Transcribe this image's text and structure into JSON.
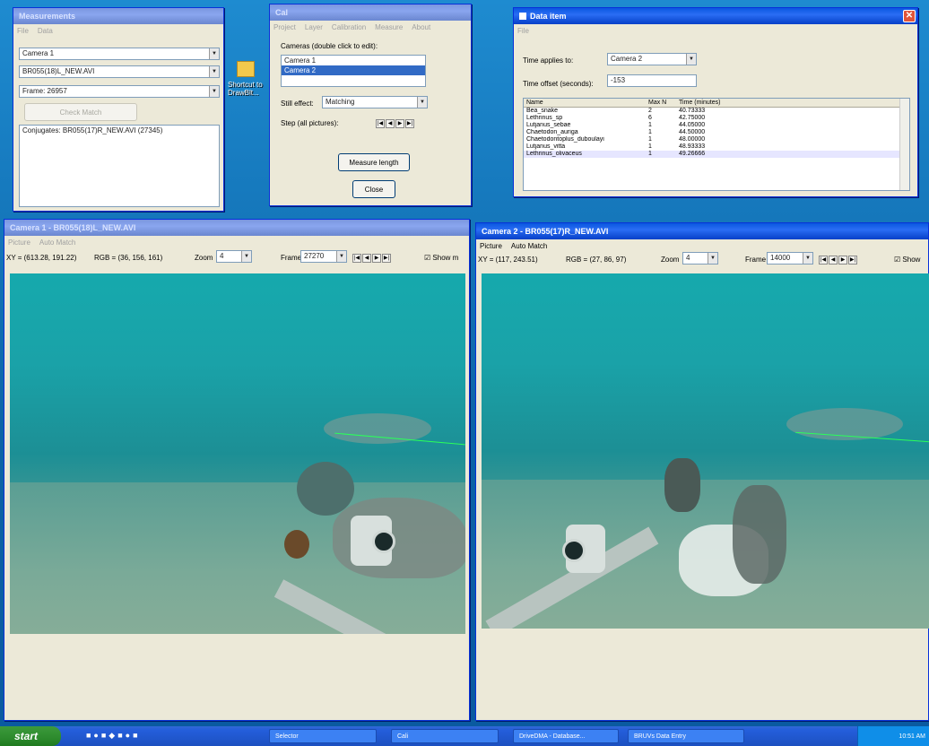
{
  "desktop": {
    "shortcut_label": "Shortcut to DrawBlt..."
  },
  "measurements": {
    "title": "Measurements",
    "menu": [
      "File",
      "Data"
    ],
    "camera_select": "Camera 1",
    "file_select": "BR055(18)L_NEW.AVI",
    "frame_select": "Frame: 26957",
    "disabled_button": "Check Match",
    "conjugate_text": "Conjugates: BR055(17)R_NEW.AVI (27345)"
  },
  "cal": {
    "title": "Cal",
    "menu": [
      "Project",
      "Layer",
      "Calibration",
      "Measure",
      "About"
    ],
    "cameras_label": "Cameras (double click to edit):",
    "cameras": [
      "Camera 1",
      "Camera 2"
    ],
    "stills_label": "Still effect:",
    "stills_value": "Matching",
    "step_label": "Step (all pictures):",
    "measure_button": "Measure length",
    "close_button": "Close"
  },
  "data_item": {
    "title": "Data item",
    "menu": [
      "File"
    ],
    "time_applies_label": "Time applies to:",
    "time_applies_value": "Camera 2",
    "time_offset_label": "Time offset (seconds):",
    "time_offset_value": "-153",
    "columns": [
      "Name",
      "Max N",
      "Time (minutes)"
    ],
    "rows": [
      [
        "Bea_snake",
        "2",
        "40.73333"
      ],
      [
        "Lethrinus_sp",
        "6",
        "42.75000"
      ],
      [
        "Lutjanus_sebae",
        "1",
        "44.05000"
      ],
      [
        "Chaetodon_auriga",
        "1",
        "44.50000"
      ],
      [
        "Chaetodontoplus_duboulayi",
        "1",
        "48.00000"
      ],
      [
        "Lutjanus_vitta",
        "1",
        "48.93333"
      ],
      [
        "Lethrinus_olivaceus",
        "1",
        "49.26666"
      ]
    ]
  },
  "camera1": {
    "title": "Camera 1 - BR055(18)L_NEW.AVI",
    "menu": [
      "Picture",
      "Auto Match"
    ],
    "xy": "XY = (613.28, 191.22)",
    "rgb": "RGB = (36, 156, 161)",
    "zoom_label": "Zoom",
    "zoom_value": "4",
    "frame_label": "Frame",
    "frame_value": "27270",
    "show_label": "Show m"
  },
  "camera2": {
    "title": "Camera 2 - BR055(17)R_NEW.AVI",
    "menu": [
      "Picture",
      "Auto Match"
    ],
    "xy": "XY = (117, 243.51)",
    "rgb": "RGB = (27, 86, 97)",
    "zoom_label": "Zoom",
    "zoom_value": "4",
    "frame_label": "Frame",
    "frame_value": "14000",
    "show_label": "Show"
  },
  "taskbar": {
    "start_label": "start",
    "tasks": [
      "Selector",
      "Cali",
      "DriveDMA - Database...",
      "BRUVs Data Entry"
    ],
    "clock": "10:51 AM"
  },
  "colors": {
    "titlebar_active": "#0a58e0",
    "titlebar_inactive": "#7a96df",
    "window_bg": "#ece9d8",
    "water": "#16a9ad",
    "measure_line": "#2bff5a"
  }
}
